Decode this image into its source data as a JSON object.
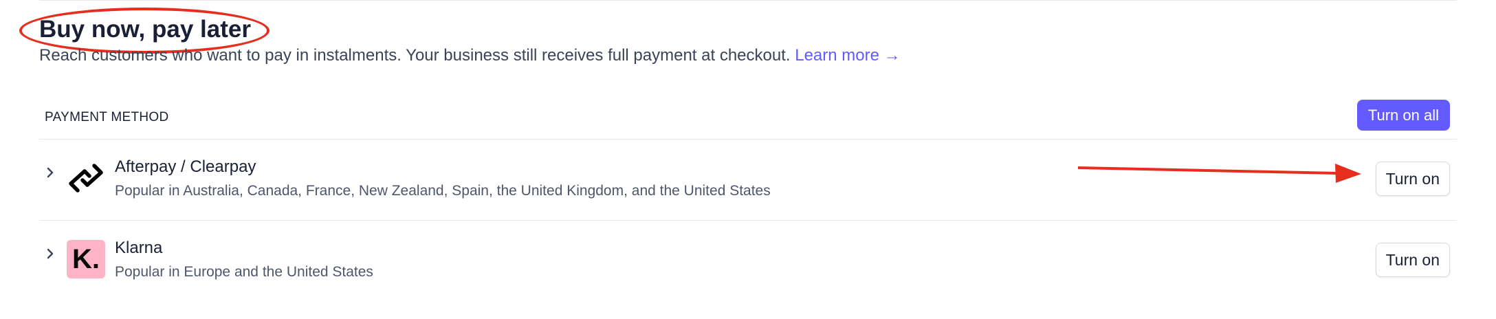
{
  "header": {
    "title": "Buy now, pay later",
    "description": "Reach customers who want to pay in instalments. Your business still receives full payment at checkout.",
    "learn_more_label": "Learn more →"
  },
  "table": {
    "column_header": "PAYMENT METHOD",
    "turn_on_all_label": "Turn on all"
  },
  "methods": [
    {
      "name": "Afterpay / Clearpay",
      "description": "Popular in Australia, Canada, France, New Zealand, Spain, the United Kingdom, and the United States",
      "button_label": "Turn on",
      "logo_icon": "afterpay-logo-icon"
    },
    {
      "name": "Klarna",
      "description": "Popular in Europe and the United States",
      "button_label": "Turn on",
      "logo_icon": "klarna-logo-icon",
      "logo_text": "K.",
      "logo_color": "#ffb3c7"
    }
  ],
  "colors": {
    "accent": "#635bff",
    "annotation": "#e62e1f"
  }
}
